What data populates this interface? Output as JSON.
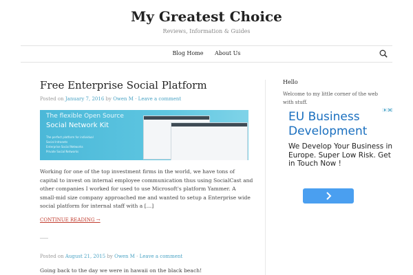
{
  "site": {
    "title": "My Greatest Choice",
    "description": "Reviews, Information & Guides"
  },
  "nav": {
    "items": [
      "Blog Home",
      "About Us"
    ]
  },
  "post1": {
    "title": "Free Enterprise Social Platform",
    "meta_prefix": "Posted on",
    "date": "January 7, 2016",
    "by": "by",
    "author": "Owen M",
    "separator": "·",
    "comment_link": "Leave a comment",
    "banner": {
      "line1": "The flexible Open Source",
      "line2": "Social Network Kit",
      "bullets": [
        "The perfect platform for individual",
        "Social Intranets",
        "Enterprise Social Networks",
        "Private Social Networks"
      ]
    },
    "excerpt": "Working for one of the top investment firms in the world, we have tons of capital to invest on internal employee communication thus using SocialCast and other companies I worked for used to use Microsoft's platform Yammer. A small-mid size company approached me and wanted to setup a Enterprise wide social platform for internal staff with a […]",
    "continue": "CONTINUE READING →"
  },
  "post2": {
    "meta_prefix": "Posted on",
    "date": "August 21, 2015",
    "by": "by",
    "author": "Owen M",
    "separator": "·",
    "comment_link": "Leave a comment",
    "excerpt": "Going back to the day we were in hawaii on the black beach!"
  },
  "sidebar": {
    "widget_title": "Hello",
    "widget_text": "Welcome to my little corner of the web with stuff.",
    "ad": {
      "headline": "EU Business Development",
      "body": "We Develop Your Business in Europe. Super Low Risk. Get in Touch Now !",
      "button_icon": "chevron-right-icon"
    }
  },
  "colors": {
    "link": "#4aa3c4",
    "continue": "#c0392b",
    "ad_headline": "#1a6fbf",
    "ad_button": "#4a9ff0"
  }
}
